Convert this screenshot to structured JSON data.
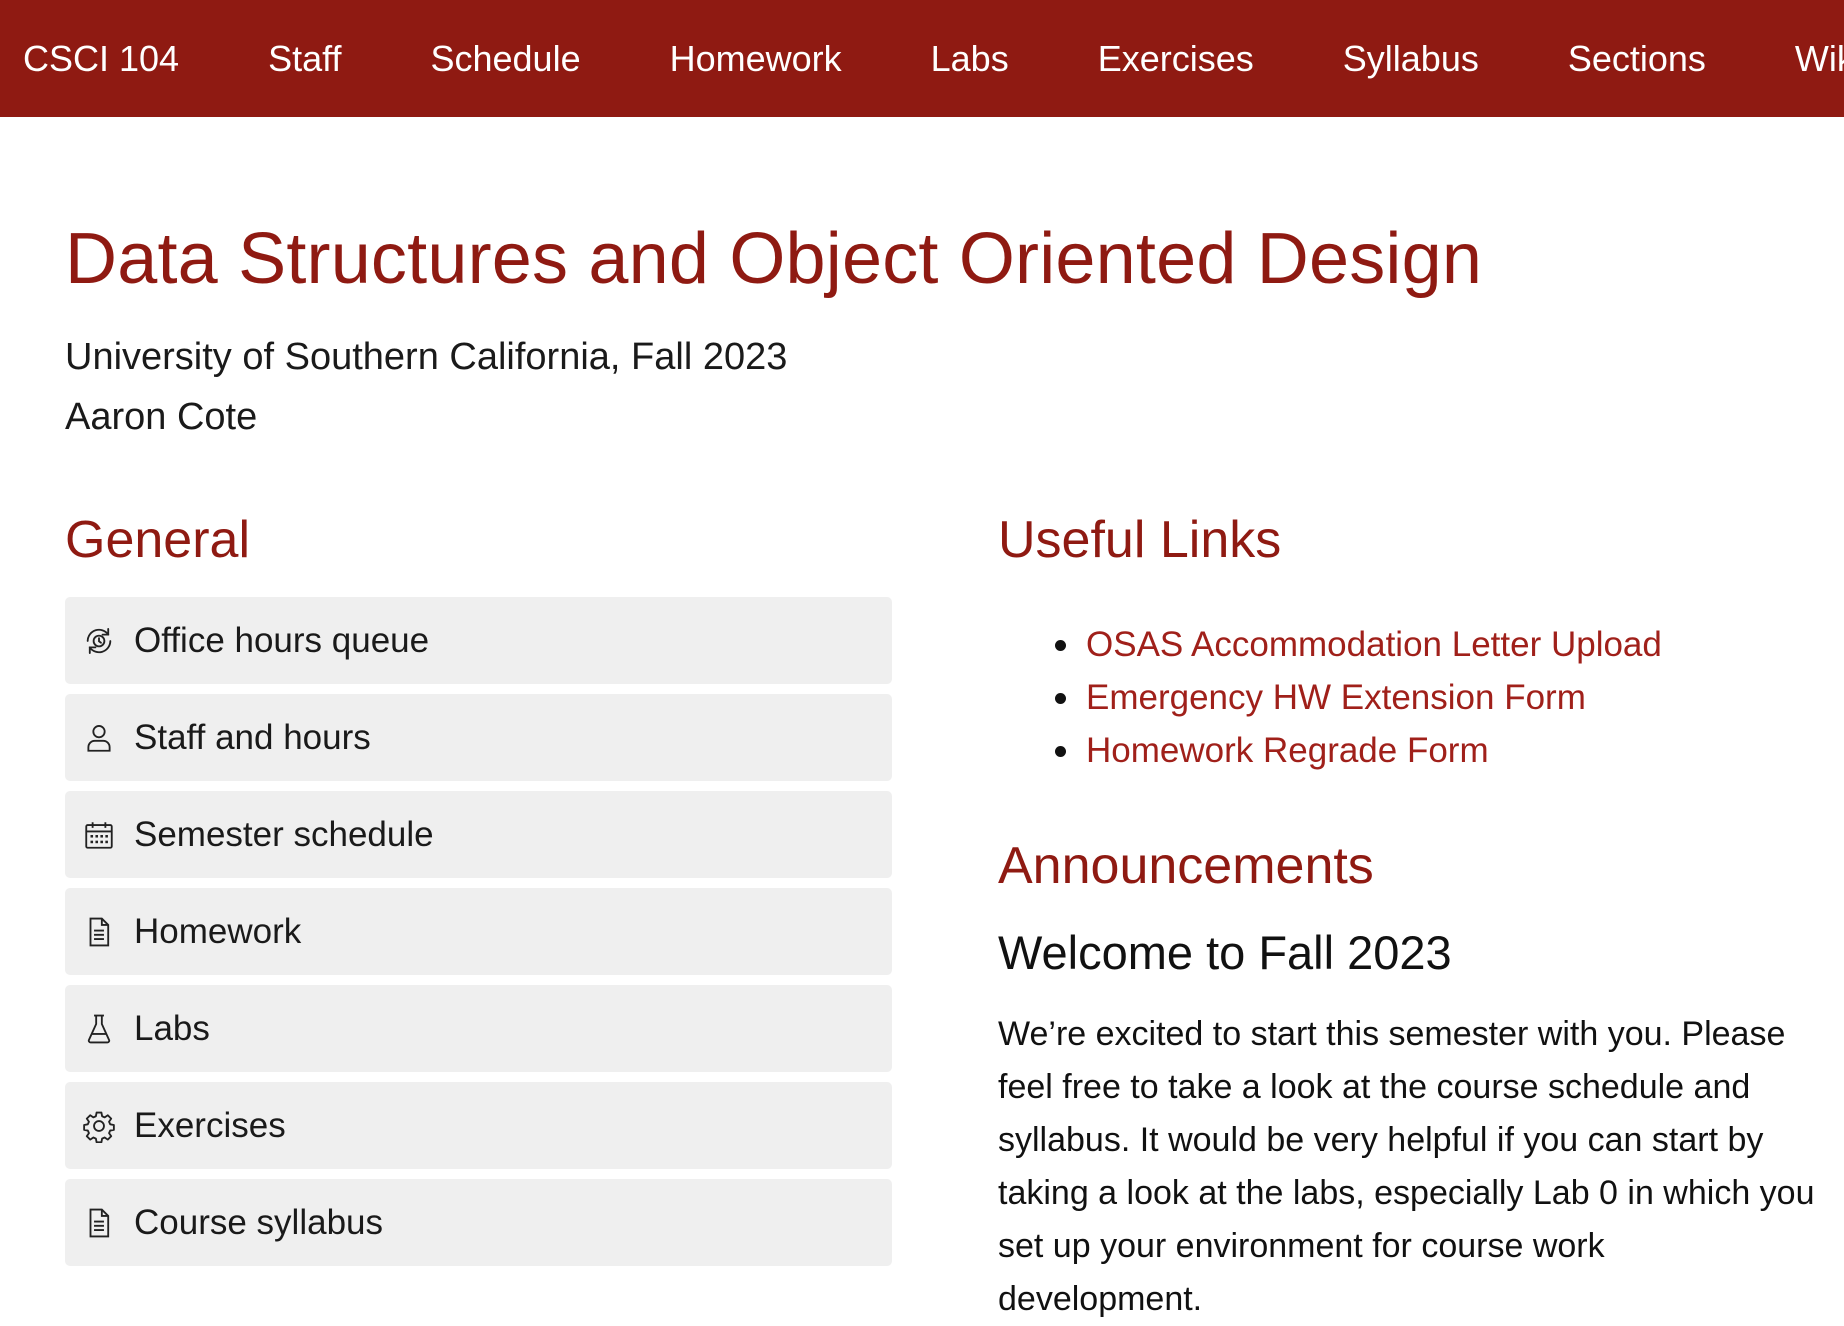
{
  "navbar": {
    "brand": "CSCI 104",
    "items": [
      "Staff",
      "Schedule",
      "Homework",
      "Labs",
      "Exercises",
      "Syllabus",
      "Sections",
      "Wiki"
    ]
  },
  "header": {
    "title": "Data Structures and Object Oriented Design",
    "subtitle": "University of Southern California, Fall 2023",
    "instructor": "Aaron Cote"
  },
  "general": {
    "heading": "General",
    "items": [
      {
        "label": "Office hours queue",
        "icon": "queue-icon"
      },
      {
        "label": "Staff and hours",
        "icon": "person-icon"
      },
      {
        "label": "Semester schedule",
        "icon": "calendar-icon"
      },
      {
        "label": "Homework",
        "icon": "document-icon"
      },
      {
        "label": "Labs",
        "icon": "flask-icon"
      },
      {
        "label": "Exercises",
        "icon": "gear-icon"
      },
      {
        "label": "Course syllabus",
        "icon": "document-icon"
      }
    ]
  },
  "useful_links": {
    "heading": "Useful Links",
    "items": [
      "OSAS Accommodation Letter Upload",
      "Emergency HW Extension Form",
      "Homework Regrade Form"
    ]
  },
  "announcements": {
    "heading": "Announcements",
    "title": "Welcome to Fall 2023",
    "body": "We’re excited to start this semester with you. Please feel free to take a look at the course schedule and syllabus. It would be very helpful if you can start by taking a look at the labs, especially Lab 0 in which you set up your environment for course work development."
  },
  "colors": {
    "brand": "#8f1a12",
    "link": "#a0201a",
    "card_bg": "#efefef"
  }
}
